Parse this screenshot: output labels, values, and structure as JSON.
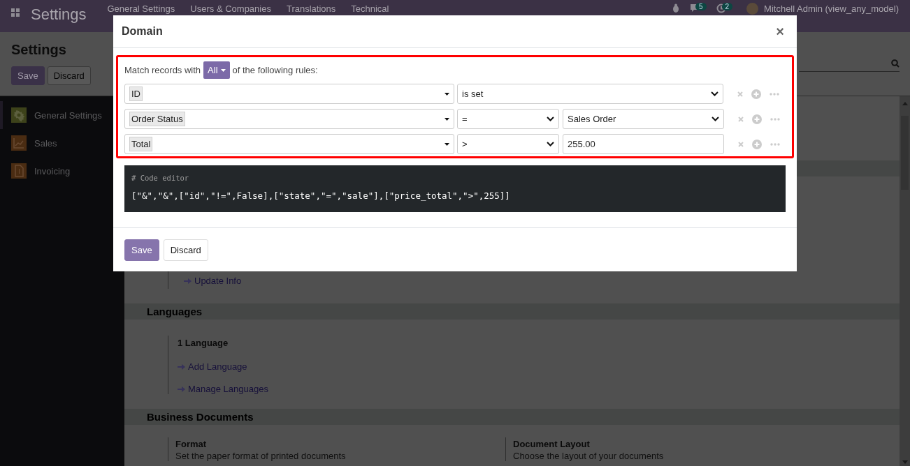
{
  "navbar": {
    "app_title": "Settings",
    "menu": [
      "General Settings",
      "Users & Companies",
      "Translations",
      "Technical"
    ],
    "messages_badge": "5",
    "activities_badge": "2",
    "user": "Mitchell Admin (view_any_model)"
  },
  "control_panel": {
    "title": "Settings",
    "buttons": [
      "Save",
      "Discard"
    ]
  },
  "sidebar": {
    "items": [
      {
        "label": "General Settings",
        "selected": true,
        "kind": "gear",
        "color": "#3d421a"
      },
      {
        "label": "Sales",
        "selected": false,
        "kind": "chart",
        "color": "#4a2c12"
      },
      {
        "label": "Invoicing",
        "selected": false,
        "kind": "document",
        "color": "#4a2c12"
      }
    ]
  },
  "content": {
    "links": [
      "Update Info"
    ],
    "sections": [
      {
        "title": "Languages",
        "settings": [
          {
            "title": "1 Language",
            "links": [
              "Add Language",
              "Manage Languages"
            ]
          }
        ]
      },
      {
        "title": "Business Documents",
        "settings": [
          {
            "title": "Format",
            "description": "Set the paper format of printed documents"
          },
          {
            "title": "Document Layout",
            "description": "Choose the layout of your documents"
          }
        ]
      }
    ]
  },
  "dialog": {
    "title": "Domain",
    "close": "×",
    "match_prefix": "Match records with",
    "match_selector": "All",
    "match_suffix": "of the following rules:",
    "rules": [
      {
        "field": "ID",
        "operator": "is set",
        "kind": "none"
      },
      {
        "field": "Order Status",
        "operator": "=",
        "kind": "select",
        "value": "Sales Order"
      },
      {
        "field": "Total",
        "operator": ">",
        "kind": "input",
        "value": "255.00"
      }
    ],
    "code_editor": {
      "comment": "# Code editor",
      "code": "[\"&\",\"&\",[\"id\",\"!=\",False],[\"state\",\"=\",\"sale\"],[\"price_total\",\">\",255]]"
    },
    "buttons": [
      "Save",
      "Discard"
    ]
  }
}
